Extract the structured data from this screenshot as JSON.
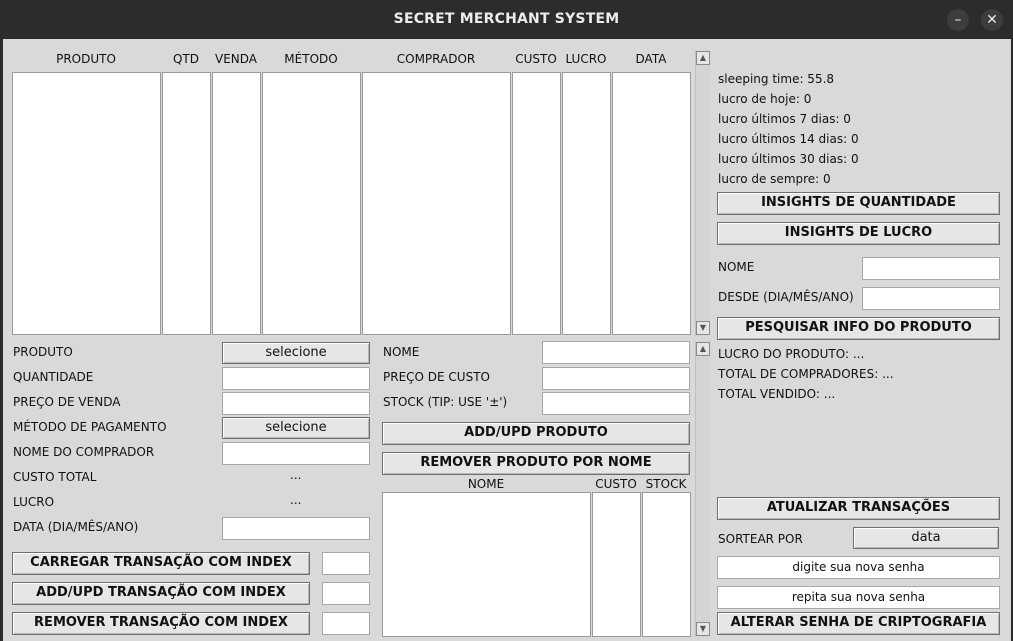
{
  "window": {
    "title": "SECRET MERCHANT SYSTEM",
    "minimize_glyph": "–",
    "close_glyph": "✕"
  },
  "transactions": {
    "columns": [
      "PRODUTO",
      "QTD",
      "VENDA",
      "MÉTODO",
      "COMPRADOR",
      "CUSTO",
      "LUCRO",
      "DATA"
    ]
  },
  "stats": {
    "sleeping_time": "sleeping time: 55.8",
    "lucro_hoje": "lucro de hoje: 0",
    "lucro_7": "lucro últimos 7 dias: 0",
    "lucro_14": "lucro últimos 14 dias: 0",
    "lucro_30": "lucro últimos 30 dias: 0",
    "lucro_sempre": "lucro de sempre: 0"
  },
  "insights": {
    "quantidade_label": "INSIGHTS DE QUANTIDADE",
    "lucro_label": "INSIGHTS DE LUCRO",
    "nome_label": "NOME",
    "desde_label": "DESDE (DIA/MÊS/ANO)",
    "pesquisar_label": "PESQUISAR INFO DO PRODUTO",
    "lucro_produto": "LUCRO DO PRODUTO: ...",
    "total_compradores": "TOTAL DE COMPRADORES: ...",
    "total_vendido": "TOTAL VENDIDO: ..."
  },
  "transaction_form": {
    "produto_label": "PRODUTO",
    "produto_select": "selecione",
    "quantidade_label": "QUANTIDADE",
    "preco_venda_label": "PREÇO DE VENDA",
    "metodo_label": "MÉTODO DE PAGAMENTO",
    "metodo_select": "selecione",
    "comprador_label": "NOME DO COMPRADOR",
    "custo_total_label": "CUSTO TOTAL",
    "custo_total_value": "...",
    "lucro_label": "LUCRO",
    "lucro_value": "...",
    "data_label": "DATA (DIA/MÊS/ANO)",
    "carregar_label": "CARREGAR TRANSAÇÃO COM INDEX",
    "addupd_label": "ADD/UPD TRANSAÇÃO COM INDEX",
    "remover_label": "REMOVER TRANSAÇÃO COM INDEX"
  },
  "product_form": {
    "nome_label": "NOME",
    "preco_custo_label": "PREÇO DE CUSTO",
    "stock_label": "STOCK (TIP: USE  '±')",
    "addupd_label": "ADD/UPD PRODUTO",
    "remover_label": "REMOVER PRODUTO POR NOME",
    "columns": [
      "NOME",
      "CUSTO",
      "STOCK"
    ]
  },
  "right_bottom": {
    "atualizar_label": "ATUALIZAR TRANSAÇÕES",
    "sortear_label": "SORTEAR POR",
    "sortear_value": "data",
    "nova_senha": "digite sua nova senha",
    "repita_senha": "repita sua nova senha",
    "alterar_label": "ALTERAR SENHA DE CRIPTOGRAFIA"
  }
}
